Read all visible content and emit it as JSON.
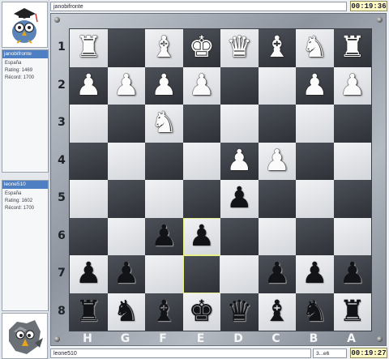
{
  "top_player": {
    "name": "janobifronte",
    "country": "España",
    "rating": "Rating: 1469",
    "record": "Récord: 1700",
    "clock": "00:19:36"
  },
  "bottom_player": {
    "name": "leone510",
    "country": "España",
    "rating": "Rating: 1602",
    "record": "Récord: 1700",
    "clock": "00:19:27"
  },
  "last_move": "3...e6",
  "board": {
    "ranks": [
      "1",
      "2",
      "3",
      "4",
      "5",
      "6",
      "7",
      "8"
    ],
    "files": [
      "H",
      "G",
      "F",
      "E",
      "D",
      "C",
      "B",
      "A"
    ],
    "highlighted": [
      [
        5,
        3
      ],
      [
        6,
        3
      ]
    ],
    "rows": [
      [
        "wR",
        "",
        "wB",
        "wK",
        "wQ",
        "wB",
        "wN",
        "wR"
      ],
      [
        "wP",
        "wP",
        "wP",
        "wP",
        "",
        "",
        "wP",
        "wP"
      ],
      [
        "",
        "",
        "wN",
        "",
        "",
        "",
        "",
        ""
      ],
      [
        "",
        "",
        "",
        "",
        "wP",
        "wP",
        "",
        ""
      ],
      [
        "",
        "",
        "",
        "",
        "bP",
        "",
        "",
        ""
      ],
      [
        "",
        "",
        "bP",
        "bP",
        "",
        "",
        "",
        ""
      ],
      [
        "bP",
        "bP",
        "",
        "",
        "",
        "bP",
        "bP",
        "bP"
      ],
      [
        "bR",
        "bN",
        "bB",
        "bK",
        "bQ",
        "bB",
        "bN",
        "bR"
      ]
    ]
  },
  "icons": {
    "top_avatar": "owl-icon",
    "bottom_avatar": "hawk-icon"
  }
}
